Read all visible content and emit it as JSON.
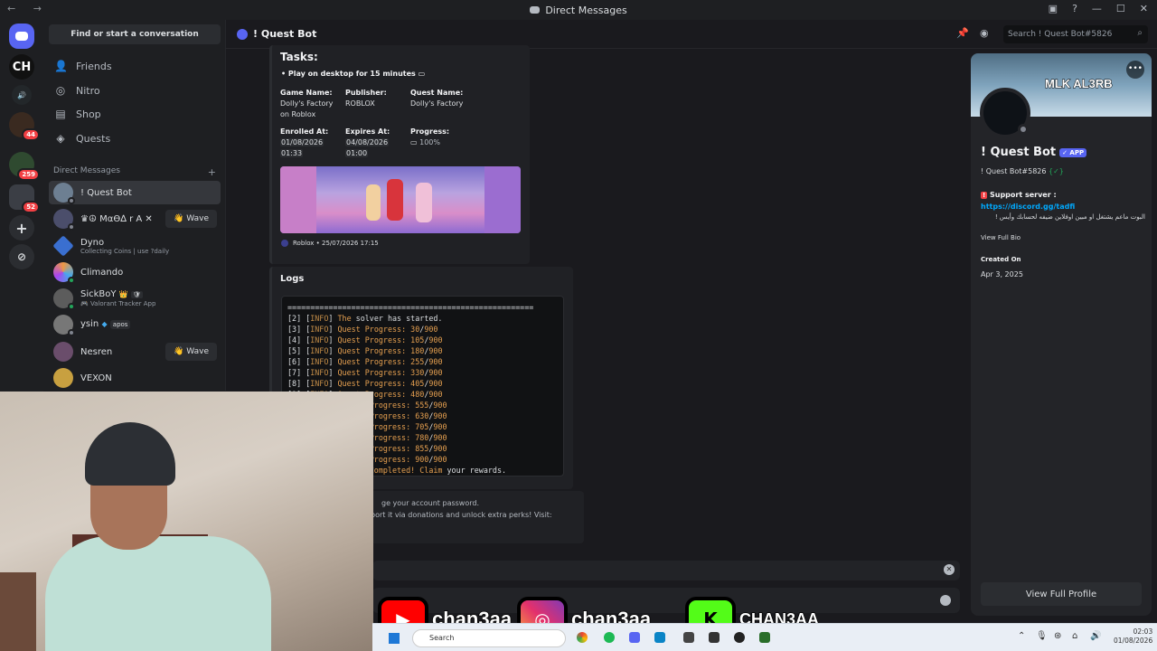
{
  "window": {
    "title": "Direct Messages",
    "nav_arrows": "←  →"
  },
  "guilds": {
    "badges": [
      "44",
      "259",
      "52"
    ],
    "ch_label": "CH"
  },
  "sidebar": {
    "find_button": "Find or start a conversation",
    "nav": [
      {
        "label": "Friends",
        "icon": "friends-icon"
      },
      {
        "label": "Nitro",
        "icon": "nitro-icon"
      },
      {
        "label": "Shop",
        "icon": "shop-icon"
      },
      {
        "label": "Quests",
        "icon": "quests-icon"
      }
    ],
    "dm_header": "Direct Messages",
    "dms": [
      {
        "name": "! Quest Bot",
        "sub": ""
      },
      {
        "name": "♛☮ MαƟ∆ r A ✕",
        "sub": "",
        "wave": "👋 Wave"
      },
      {
        "name": "Dyno",
        "sub": "Collecting Coins | use ?daily"
      },
      {
        "name": "Climando",
        "sub": ""
      },
      {
        "name": "SickBoY",
        "sub": "🎮 Valorant Tracker App"
      },
      {
        "name": "ysin",
        "sub": "",
        "tag": "apos"
      },
      {
        "name": "Nesren",
        "sub": "",
        "wave": "👋 Wave"
      },
      {
        "name": "VEXON",
        "sub": ""
      }
    ]
  },
  "topbar": {
    "channel_name": "! Quest Bot",
    "search_placeholder": "Search ! Quest Bot#5826"
  },
  "quest_embed": {
    "title": "Tasks:",
    "task": "Play on desktop for 15 minutes",
    "game_name_label": "Game Name:",
    "game_name": "Dolly's Factory on Roblox",
    "publisher_label": "Publisher:",
    "publisher": "ROBLOX",
    "quest_name_label": "Quest Name:",
    "quest_name": "Dolly's Factory",
    "enrolled_label": "Enrolled At:",
    "enrolled_date": "01/08/2026",
    "enrolled_time": "01:33",
    "expires_label": "Expires At:",
    "expires_date": "04/08/2026",
    "expires_time": "01:00",
    "progress_label": "Progress:",
    "progress": "100%",
    "footer": "Roblox • 25/07/2026 17:15"
  },
  "logs": {
    "title": "Logs",
    "separator": "======================================================",
    "started": {
      "n": "2",
      "text": "The solver has started."
    },
    "lines": [
      {
        "n": "3",
        "v": "30"
      },
      {
        "n": "4",
        "v": "105"
      },
      {
        "n": "5",
        "v": "180"
      },
      {
        "n": "6",
        "v": "255"
      },
      {
        "n": "7",
        "v": "330"
      },
      {
        "n": "8",
        "v": "405"
      },
      {
        "n": "9",
        "v": "480"
      }
    ],
    "tail_lines": [
      "555",
      "630",
      "705",
      "780",
      "855",
      "900"
    ],
    "total": "900",
    "info_tag": "INFO",
    "progress_word": "Quest Progress:",
    "progress_short": "Progress:",
    "completed": "Completed! Claim your rewards."
  },
  "partial_message": {
    "line1": "ge your account password.",
    "line2": "port it via donations and unlock extra perks! Visit:"
  },
  "profile": {
    "banner_text": "MLK AL3RB",
    "name": "! Quest Bot",
    "app_tag": "✓ APP",
    "username": "! Quest Bot#5826",
    "support_label": "Support server :",
    "support_link": "https://discord.gg/tadfi",
    "arabic_note": "البوت ماعم يشتغل او مبين اوفلاين ضيفه لحسابك وأيس !",
    "view_bio": "View Full Bio",
    "created_label": "Created On",
    "created_date": "Apr 3, 2025",
    "full_profile_button": "View Full Profile"
  },
  "overlay": {
    "youtube": "chan3aa",
    "instagram": "chan3aa_",
    "kick": "CHAN3AA"
  },
  "taskbar": {
    "search": "Search",
    "time": "02:03",
    "date": "01/08/2026"
  }
}
